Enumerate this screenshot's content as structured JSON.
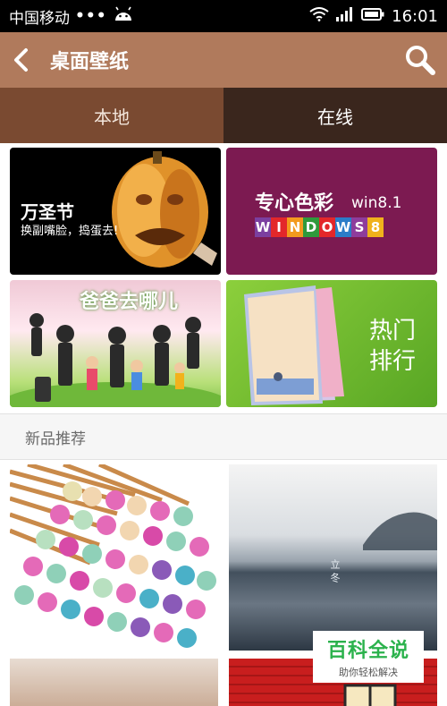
{
  "statusbar": {
    "carrier": "中国移动",
    "dots": "•••",
    "time": "16:01",
    "icons": [
      "android-icon",
      "wifi-icon",
      "signal-icon",
      "battery-icon"
    ]
  },
  "appbar": {
    "title": "桌面壁纸",
    "back_icon": "chevron-left-icon",
    "search_icon": "search-icon",
    "background": "#b07a5c"
  },
  "tabs": [
    {
      "label": "本地",
      "selected": false
    },
    {
      "label": "在线",
      "selected": true
    }
  ],
  "banners": {
    "halloween": {
      "title": "万圣节",
      "subtitle": "换副嘴脸，捣蛋去!"
    },
    "windows": {
      "title": "专心色彩",
      "version": "win8.1",
      "word": [
        "W",
        "I",
        "N",
        "D",
        "O",
        "W",
        "S",
        "8"
      ]
    },
    "dad": {
      "logo": "爸爸去哪儿"
    },
    "hot": {
      "label": "热门排行"
    }
  },
  "section": {
    "title": "新品推荐"
  },
  "thumbnails": [
    {
      "name": "matches"
    },
    {
      "name": "winter-lake",
      "caption": "立冬"
    },
    {
      "name": "sand"
    },
    {
      "name": "red-wall"
    }
  ],
  "watermark": {
    "big": "百科全说",
    "small": "助你轻松解决"
  },
  "colors": {
    "tab_local": "#7a4a31",
    "tab_online": "#3a261d",
    "windows_bg": "#7c1a51",
    "hot_bg": "#6fba2e"
  }
}
